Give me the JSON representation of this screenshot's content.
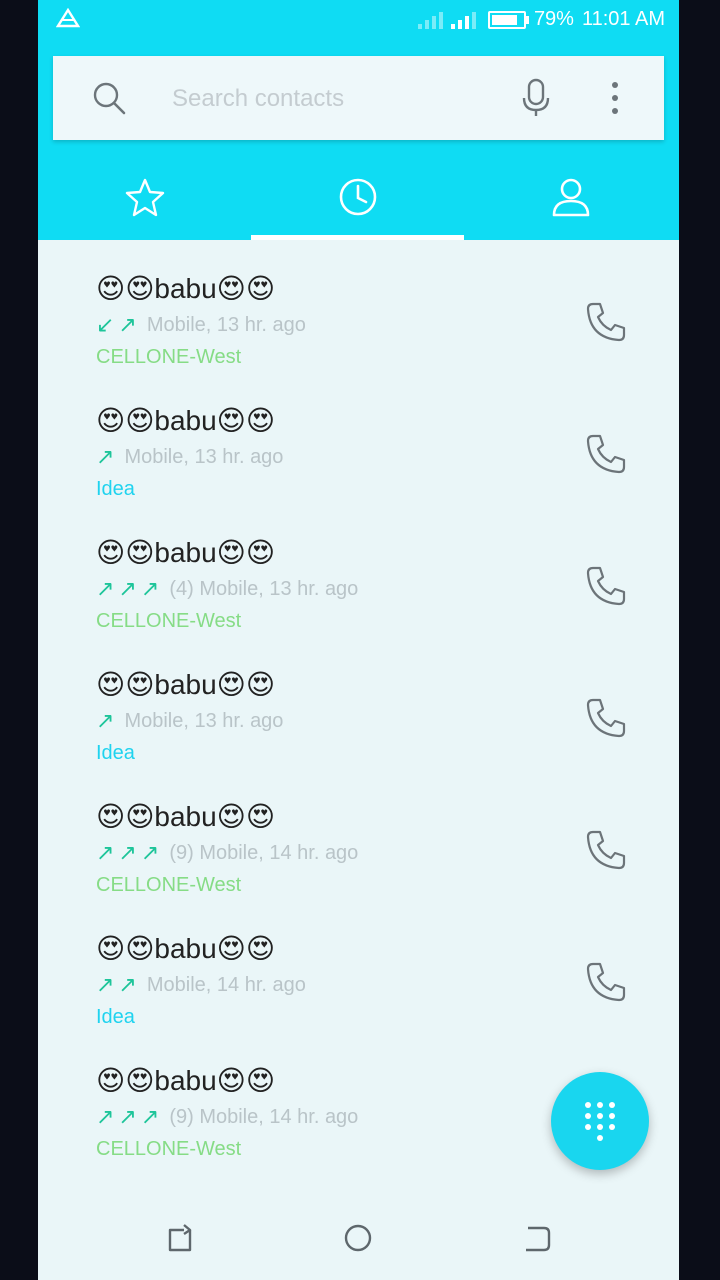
{
  "status_bar": {
    "battery": "79%",
    "time": "11:01 AM"
  },
  "search": {
    "placeholder": "Search contacts"
  },
  "tabs": [
    {
      "icon": "star-icon"
    },
    {
      "icon": "clock-icon",
      "selected": true
    },
    {
      "icon": "person-icon"
    }
  ],
  "calls": [
    {
      "name": "😍😍babu😍😍",
      "arrows": "↙↗",
      "detail": "Mobile, 13 hr. ago",
      "carrier": "CELLONE-West"
    },
    {
      "name": "😍😍babu😍😍",
      "arrows": "↗",
      "detail": "Mobile, 13 hr. ago",
      "carrier": "Idea"
    },
    {
      "name": "😍😍babu😍😍",
      "arrows": "↗↗↗",
      "detail": "(4) Mobile, 13 hr. ago",
      "carrier": "CELLONE-West"
    },
    {
      "name": "😍😍babu😍😍",
      "arrows": "↗",
      "detail": "Mobile, 13 hr. ago",
      "carrier": "Idea"
    },
    {
      "name": "😍😍babu😍😍",
      "arrows": "↗↗↗",
      "detail": "(9) Mobile, 14 hr. ago",
      "carrier": "CELLONE-West"
    },
    {
      "name": "😍😍babu😍😍",
      "arrows": "↗↗",
      "detail": "Mobile, 14 hr. ago",
      "carrier": "Idea"
    },
    {
      "name": "😍😍babu😍😍",
      "arrows": "↗↗↗",
      "detail": "(9) Mobile, 14 hr. ago",
      "carrier": "CELLONE-West"
    }
  ],
  "colors": {
    "accent": "#0fdcf3",
    "outgoing_arrow": "#1ec59a",
    "cellone": "#86dc86",
    "idea": "#1fd3ef"
  }
}
